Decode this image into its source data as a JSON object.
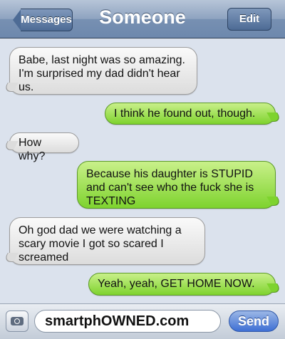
{
  "nav": {
    "back_label": "Messages",
    "title": "Someone",
    "edit_label": "Edit"
  },
  "messages": [
    {
      "direction": "incoming",
      "text": "Babe, last night was so amazing. I'm surprised my dad didn't hear us."
    },
    {
      "direction": "outgoing",
      "text": "I think he found out, though."
    },
    {
      "direction": "incoming",
      "text": "How why?"
    },
    {
      "direction": "outgoing",
      "text": "Because his daughter is STUPID and can't see who the fuck she is TEXTING"
    },
    {
      "direction": "incoming",
      "text": "Oh god dad we were watching a scary movie I got so scared I screamed"
    },
    {
      "direction": "outgoing",
      "text": "Yeah, yeah, GET HOME NOW."
    }
  ],
  "composer": {
    "camera_icon": "camera-icon",
    "input_value": "smartphOWNED.com",
    "send_label": "Send"
  },
  "colors": {
    "incoming_bubble": "#e8e8e8",
    "outgoing_bubble": "#8fd93a",
    "nav_bar": "#7c93b5",
    "send_button": "#3e6fd4"
  }
}
